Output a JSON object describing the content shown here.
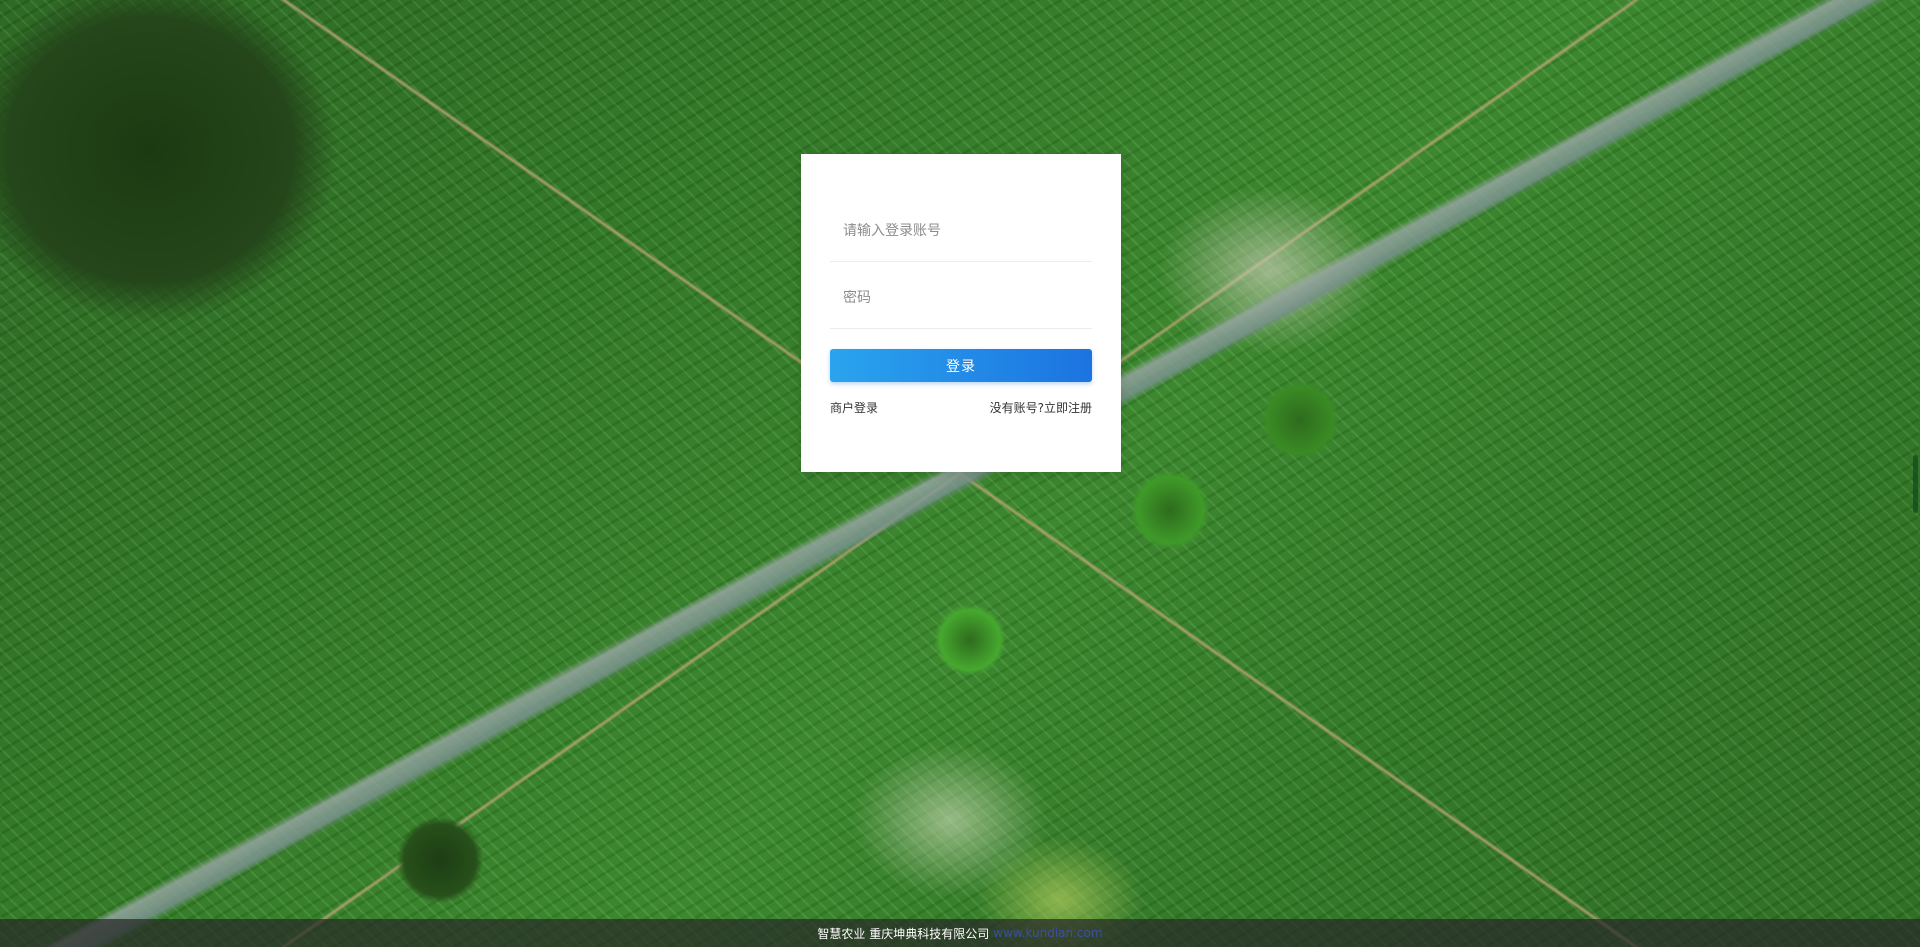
{
  "login": {
    "username_placeholder": "请输入登录账号",
    "password_placeholder": "密码",
    "login_label": "登录",
    "merchant_login_label": "商户登录",
    "register_label": "没有账号?立即注册"
  },
  "footer": {
    "text": "智慧农业 重庆坤典科技有限公司",
    "link_text": "www.kundian.com"
  },
  "colors": {
    "button_gradient_start": "#2aa4ee",
    "button_gradient_end": "#1c73e0",
    "footer_bg": "#282828"
  }
}
